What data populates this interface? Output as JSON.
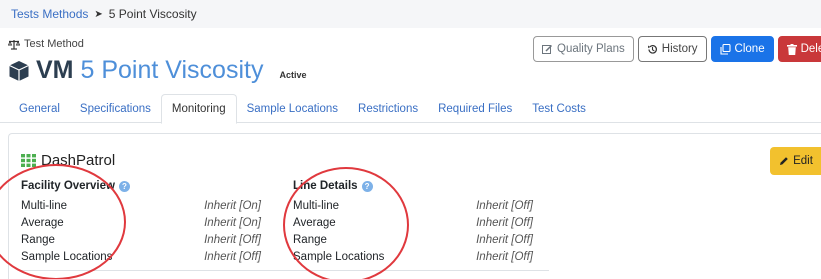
{
  "breadcrumb": {
    "parent": "Tests Methods",
    "current": "5 Point Viscosity"
  },
  "header": {
    "subtitle": "Test Method",
    "code": "VM",
    "name": "5 Point Viscosity",
    "status": "Active"
  },
  "actions": {
    "quality_plans": "Quality Plans",
    "history": "History",
    "clone": "Clone",
    "delete": "Delete"
  },
  "tabs": [
    "General",
    "Specifications",
    "Monitoring",
    "Sample Locations",
    "Restrictions",
    "Required Files",
    "Test Costs"
  ],
  "active_tab": "Monitoring",
  "panel": {
    "title": "DashPatrol",
    "edit_label": "Edit",
    "facility": {
      "heading": "Facility Overview",
      "rows": [
        {
          "label": "Multi-line",
          "value": "Inherit [On]"
        },
        {
          "label": "Average",
          "value": "Inherit [On]"
        },
        {
          "label": "Range",
          "value": "Inherit [Off]"
        },
        {
          "label": "Sample Locations",
          "value": "Inherit [Off]"
        }
      ]
    },
    "line": {
      "heading": "Line Details",
      "rows": [
        {
          "label": "Multi-line",
          "value": "Inherit [Off]"
        },
        {
          "label": "Average",
          "value": "Inherit [Off]"
        },
        {
          "label": "Range",
          "value": "Inherit [Off]"
        },
        {
          "label": "Sample Locations",
          "value": "Inherit [Off]"
        }
      ]
    }
  },
  "colors": {
    "link": "#3a6fc4",
    "title_blue": "#4e8fd9",
    "clone": "#1a73e8",
    "delete": "#c9383a",
    "edit": "#f2c12e",
    "annotation": "#e0393e"
  },
  "icons": {
    "subtitle": "balance-scale-icon",
    "title": "cube-icon",
    "quality": "pencil-square-icon",
    "history": "history-icon",
    "clone": "copy-icon",
    "delete": "trash-icon",
    "panel": "grid-icon",
    "edit": "pencil-icon",
    "info": "question-circle-icon"
  }
}
